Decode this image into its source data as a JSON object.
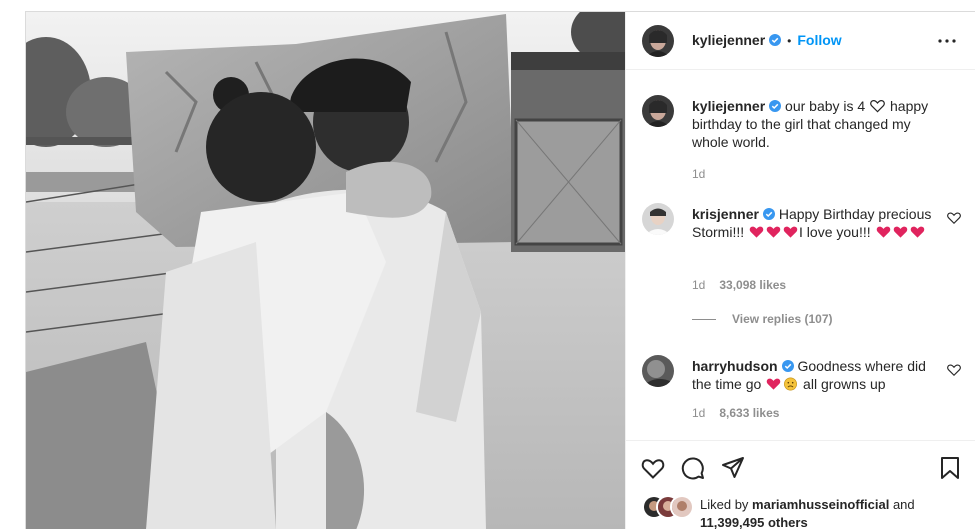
{
  "post": {
    "username": "kyliejenner",
    "follow_label": "Follow",
    "separator": "•"
  },
  "caption": {
    "username": "kyliejenner",
    "text_before_heart": "our baby is 4",
    "text_after_heart": "happy birthday to the girl that changed my whole world.",
    "time": "1d"
  },
  "comments": [
    {
      "username": "krisjenner",
      "text_a": "Happy Birthday precious Stormi!!!",
      "text_b": "I love you!!!",
      "time": "1d",
      "likes": "33,098 likes",
      "view_replies": "View replies (107)"
    },
    {
      "username": "harryhudson",
      "text_a": "Goodness where did the time go",
      "text_b": "all growns up",
      "time": "1d",
      "likes": "8,633 likes"
    }
  ],
  "likes": {
    "prefix": "Liked by",
    "user": "mariamhusseinofficial",
    "and": "and",
    "others": "11,399,495 others"
  },
  "icons": {
    "verified": "verified-badge-icon",
    "more": "more-options-icon",
    "like": "heart-icon",
    "comment": "comment-icon",
    "share": "paper-plane-icon",
    "save": "bookmark-icon"
  },
  "colors": {
    "accent": "#0095f6",
    "verified": "#3897f0",
    "emoji_heart": "#e0245e",
    "muted": "#8e8e8e",
    "divider": "#efefef"
  }
}
